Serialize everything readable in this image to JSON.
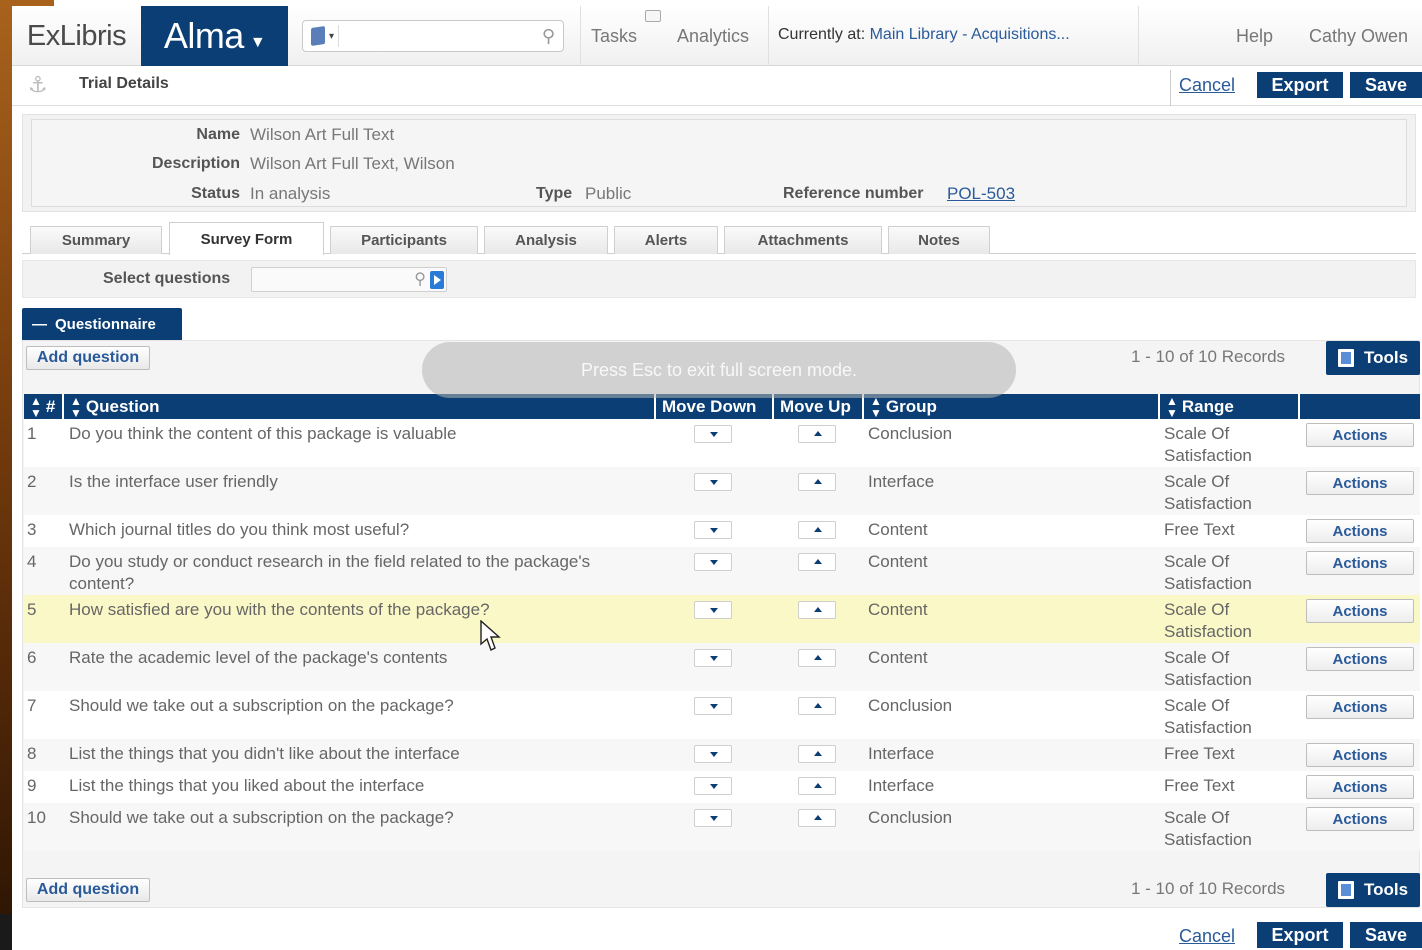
{
  "header": {
    "logo": "ExLibris",
    "app_name": "Alma",
    "search_placeholder": "",
    "nav_tasks": "Tasks",
    "nav_analytics": "Analytics",
    "currently_at_label": "Currently at:",
    "currently_at_value": "Main Library - Acquisitions...",
    "help": "Help",
    "user": "Cathy Owen"
  },
  "titlebar": {
    "title": "Trial Details",
    "cancel": "Cancel",
    "export": "Export",
    "save": "Save"
  },
  "details": {
    "name_label": "Name",
    "name_value": "Wilson Art Full Text",
    "description_label": "Description",
    "description_value": "Wilson Art Full Text, Wilson",
    "status_label": "Status",
    "status_value": "In analysis",
    "type_label": "Type",
    "type_value": "Public",
    "reference_label": "Reference number",
    "reference_value": "POL-503"
  },
  "tabs": [
    "Summary",
    "Survey Form",
    "Participants",
    "Analysis",
    "Alerts",
    "Attachments",
    "Notes"
  ],
  "active_tab": "Survey Form",
  "select_questions": {
    "label": "Select questions",
    "value": ""
  },
  "questionnaire": {
    "header": "Questionnaire",
    "add_question": "Add question",
    "records": "1 - 10 of 10 Records",
    "tools": "Tools",
    "columns": [
      "#",
      "Question",
      "Move Down",
      "Move Up",
      "Group",
      "Range",
      ""
    ],
    "action_label": "Actions",
    "rows": [
      {
        "num": "1",
        "question": "Do you think the content of this package is valuable",
        "group": "Conclusion",
        "range": "Scale Of Satisfaction"
      },
      {
        "num": "2",
        "question": "Is the interface user friendly",
        "group": "Interface",
        "range": "Scale Of Satisfaction"
      },
      {
        "num": "3",
        "question": "Which journal titles do you think most useful?",
        "group": "Content",
        "range": "Free Text"
      },
      {
        "num": "4",
        "question": "Do you study or conduct research in the field related to the package's content?",
        "group": "Content",
        "range": "Scale Of Satisfaction"
      },
      {
        "num": "5",
        "question": "How satisfied are you with the contents of the package?",
        "group": "Content",
        "range": "Scale Of Satisfaction"
      },
      {
        "num": "6",
        "question": "Rate the academic level of the package's contents",
        "group": "Content",
        "range": "Scale Of Satisfaction"
      },
      {
        "num": "7",
        "question": "Should we take out a subscription on the package?",
        "group": "Conclusion",
        "range": "Scale Of Satisfaction"
      },
      {
        "num": "8",
        "question": "List the things that you didn't like about the interface",
        "group": "Interface",
        "range": "Free Text"
      },
      {
        "num": "9",
        "question": "List the things that you liked about the interface",
        "group": "Interface",
        "range": "Free Text"
      },
      {
        "num": "10",
        "question": "Should we take out a subscription on the package?",
        "group": "Conclusion",
        "range": "Scale Of Satisfaction"
      }
    ]
  },
  "overlay": {
    "text": "Press Esc to exit full screen mode."
  },
  "colors": {
    "brand": "#0b3e74",
    "link": "#2a5a9a",
    "highlight_row": "#fbf8c8"
  }
}
